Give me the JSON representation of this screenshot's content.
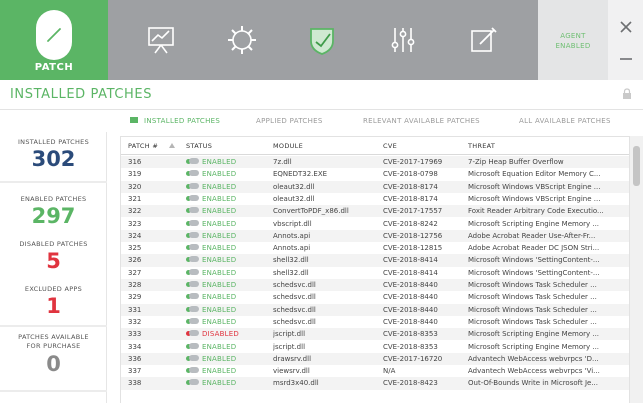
{
  "header": {
    "patch_label": "PATCH",
    "agent_status": [
      "AGENT",
      "ENABLED"
    ],
    "nav_icons": [
      "chart-presentation-icon",
      "gear-icon",
      "shield-check-icon",
      "sliders-icon",
      "edit-note-icon"
    ],
    "colors": {
      "brand_green": "#5bb565",
      "topbar_gray": "#9ea0a3",
      "enabled_green": "#5bb565",
      "disabled_red": "#e0343f",
      "installed_blue": "#2b4b7a"
    }
  },
  "page": {
    "title": "INSTALLED PATCHES"
  },
  "tabs": [
    {
      "label": "INSTALLED PATCHES",
      "active": true
    },
    {
      "label": "APPLIED PATCHES",
      "active": false
    },
    {
      "label": "RELEVANT AVAILABLE PATCHES",
      "active": false
    },
    {
      "label": "ALL AVAILABLE PATCHES",
      "active": false
    }
  ],
  "sidebar": {
    "installed": {
      "label": "INSTALLED PATCHES",
      "value": "302"
    },
    "enabled": {
      "label": "ENABLED PATCHES",
      "value": "297"
    },
    "disabled": {
      "label": "DISABLED PATCHES",
      "value": "5"
    },
    "excluded": {
      "label": "EXCLUDED APPS",
      "value": "1"
    },
    "purchase": {
      "label": [
        "PATCHES AVAILABLE",
        "FOR PURCHASE"
      ],
      "value": "0"
    }
  },
  "table": {
    "columns": {
      "patch": "PATCH #",
      "status": "STATUS",
      "module": "MODULE",
      "cve": "CVE",
      "threat": "THREAT"
    },
    "rows": [
      {
        "patch": "316",
        "status": "ENABLED",
        "module": "7z.dll",
        "cve": "CVE-2017-17969",
        "threat": "7-Zip Heap Buffer Overflow"
      },
      {
        "patch": "319",
        "status": "ENABLED",
        "module": "EQNEDT32.EXE",
        "cve": "CVE-2018-0798",
        "threat": "Microsoft Equation Editor Memory C..."
      },
      {
        "patch": "320",
        "status": "ENABLED",
        "module": "oleaut32.dll",
        "cve": "CVE-2018-8174",
        "threat": "Microsoft Windows VBScript Engine ..."
      },
      {
        "patch": "321",
        "status": "ENABLED",
        "module": "oleaut32.dll",
        "cve": "CVE-2018-8174",
        "threat": "Microsoft Windows VBScript Engine ..."
      },
      {
        "patch": "322",
        "status": "ENABLED",
        "module": "ConvertToPDF_x86.dll",
        "cve": "CVE-2017-17557",
        "threat": "Foxit Reader Arbitrary Code Executio..."
      },
      {
        "patch": "323",
        "status": "ENABLED",
        "module": "vbscript.dll",
        "cve": "CVE-2018-8242",
        "threat": "Microsoft Scripting Engine Memory ..."
      },
      {
        "patch": "324",
        "status": "ENABLED",
        "module": "Annots.api",
        "cve": "CVE-2018-12756",
        "threat": "Adobe Acrobat Reader Use-After-Fr..."
      },
      {
        "patch": "325",
        "status": "ENABLED",
        "module": "Annots.api",
        "cve": "CVE-2018-12815",
        "threat": "Adobe Acrobat Reader DC JSON Stri..."
      },
      {
        "patch": "326",
        "status": "ENABLED",
        "module": "shell32.dll",
        "cve": "CVE-2018-8414",
        "threat": "Microsoft Windows 'SettingContent-..."
      },
      {
        "patch": "327",
        "status": "ENABLED",
        "module": "shell32.dll",
        "cve": "CVE-2018-8414",
        "threat": "Microsoft Windows 'SettingContent-..."
      },
      {
        "patch": "328",
        "status": "ENABLED",
        "module": "schedsvc.dll",
        "cve": "CVE-2018-8440",
        "threat": "Microsoft Windows Task Scheduler ..."
      },
      {
        "patch": "329",
        "status": "ENABLED",
        "module": "schedsvc.dll",
        "cve": "CVE-2018-8440",
        "threat": "Microsoft Windows Task Scheduler ..."
      },
      {
        "patch": "331",
        "status": "ENABLED",
        "module": "schedsvc.dll",
        "cve": "CVE-2018-8440",
        "threat": "Microsoft Windows Task Scheduler ..."
      },
      {
        "patch": "332",
        "status": "ENABLED",
        "module": "schedsvc.dll",
        "cve": "CVE-2018-8440",
        "threat": "Microsoft Windows Task Scheduler ..."
      },
      {
        "patch": "333",
        "status": "DISABLED",
        "module": "jscript.dll",
        "cve": "CVE-2018-8353",
        "threat": "Microsoft Scripting Engine Memory ..."
      },
      {
        "patch": "334",
        "status": "ENABLED",
        "module": "jscript.dll",
        "cve": "CVE-2018-8353",
        "threat": "Microsoft Scripting Engine Memory ..."
      },
      {
        "patch": "336",
        "status": "ENABLED",
        "module": "drawsrv.dll",
        "cve": "CVE-2017-16720",
        "threat": "Advantech WebAccess webvrpcs 'D..."
      },
      {
        "patch": "337",
        "status": "ENABLED",
        "module": "viewsrv.dll",
        "cve": "N/A",
        "threat": "Advantech WebAccess webvrpcs 'Vi..."
      },
      {
        "patch": "338",
        "status": "ENABLED",
        "module": "msrd3x40.dll",
        "cve": "CVE-2018-8423",
        "threat": "Out-Of-Bounds Write in Microsoft Je..."
      }
    ]
  }
}
